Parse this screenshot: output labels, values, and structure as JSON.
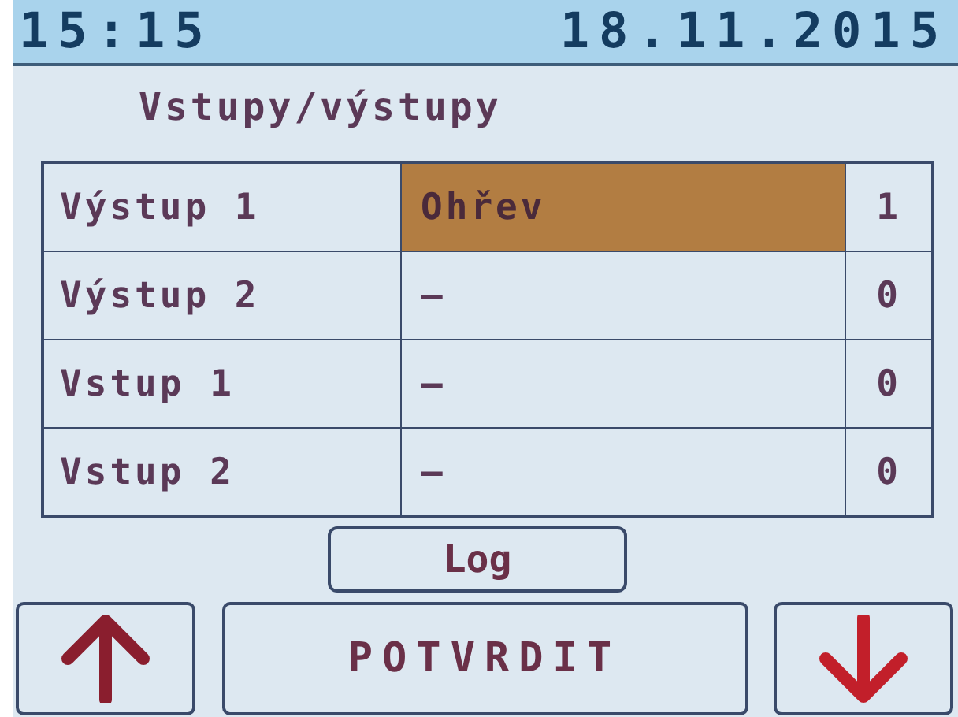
{
  "status_bar": {
    "time": "15:15",
    "date": "18.11.2015"
  },
  "title": "Vstupy/výstupy",
  "rows": [
    {
      "label": "Výstup 1",
      "value": "Ohřev",
      "state": "1",
      "selected": true
    },
    {
      "label": "Výstup 2",
      "value": "–",
      "state": "0",
      "selected": false
    },
    {
      "label": "Vstup 1",
      "value": "–",
      "state": "0",
      "selected": false
    },
    {
      "label": "Vstup 2",
      "value": "–",
      "state": "0",
      "selected": false
    }
  ],
  "log_button": "Log",
  "confirm_button": "POTVRDIT"
}
